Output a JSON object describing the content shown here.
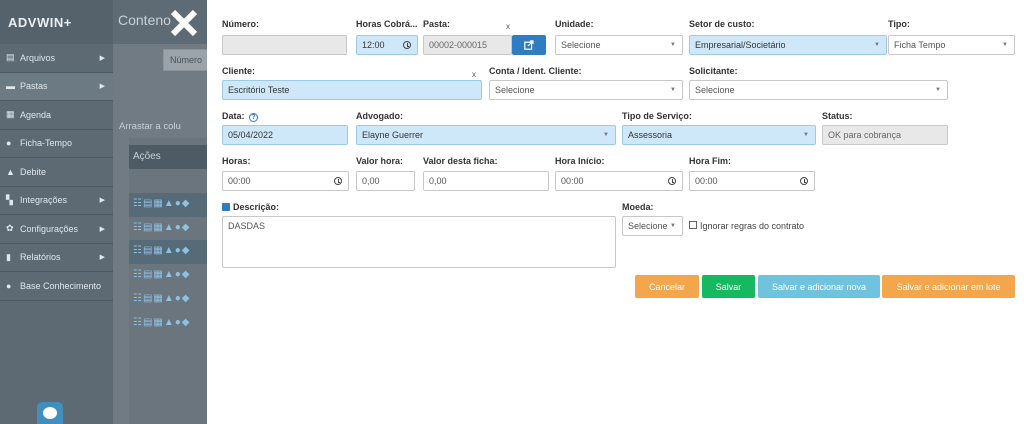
{
  "app": {
    "brand": "ADVWIN+",
    "header_title": "Conteno",
    "colors": {
      "sidebar": "#5d6a74",
      "primary": "#2f7dc0",
      "highlight_field": "#cfe8f9",
      "cancel": "#f3a64b",
      "save": "#16b95f",
      "save_new": "#6fc3df"
    }
  },
  "sidebar": {
    "items": [
      {
        "label": "Arquivos",
        "icon": "folder-icon",
        "glyph": "▤",
        "arrow": "▶"
      },
      {
        "label": "Pastas",
        "icon": "folder-open-icon",
        "glyph": "▬",
        "arrow": "▶"
      },
      {
        "label": "Agenda",
        "icon": "calendar-icon",
        "glyph": "▦",
        "arrow": ""
      },
      {
        "label": "Ficha-Tempo",
        "icon": "clock-icon",
        "glyph": "●",
        "arrow": ""
      },
      {
        "label": "Debite",
        "icon": "money-icon",
        "glyph": "▲",
        "arrow": ""
      },
      {
        "label": "Integrações",
        "icon": "sitemap-icon",
        "glyph": "▚",
        "arrow": "▶"
      },
      {
        "label": "Configurações",
        "icon": "gears-icon",
        "glyph": "✿",
        "arrow": "▶"
      },
      {
        "label": "Relatórios",
        "icon": "file-icon",
        "glyph": "▮",
        "arrow": "▶"
      },
      {
        "label": "Base Conhecimento",
        "icon": "info-icon",
        "glyph": "●",
        "arrow": ""
      }
    ]
  },
  "background": {
    "numero_placeholder": "Número",
    "arrastar_text": "Arrastar a colu",
    "acoes_header": "Ações",
    "row_icons": "☷▤▦▲●◆"
  },
  "form": {
    "numero": {
      "label": "Número:",
      "value": ""
    },
    "horas_cobradas": {
      "label": "Horas Cobrá...",
      "value": "12:00"
    },
    "pasta": {
      "label": "Pasta:",
      "value": "00002-000015",
      "clear": "x"
    },
    "unidade": {
      "label": "Unidade:",
      "value": "Selecione"
    },
    "setor_custo": {
      "label": "Setor de custo:",
      "value": "Empresarial/Societário"
    },
    "tipo": {
      "label": "Tipo:",
      "value": "Ficha Tempo"
    },
    "cliente": {
      "label": "Cliente:",
      "value": "Escritório Teste",
      "clear": "x"
    },
    "conta": {
      "label": "Conta / Ident. Cliente:",
      "value": "Selecione"
    },
    "solicitante": {
      "label": "Solicitante:",
      "value": "Selecione"
    },
    "data": {
      "label": "Data:",
      "help": "?",
      "value": "05/04/2022"
    },
    "advogado": {
      "label": "Advogado:",
      "value": "Elayne Guerrer"
    },
    "tipo_servico": {
      "label": "Tipo de Serviço:",
      "value": "Assessoria"
    },
    "status": {
      "label": "Status:",
      "value": "OK para cobrança"
    },
    "horas": {
      "label": "Horas:",
      "value": "00:00"
    },
    "valor_hora": {
      "label": "Valor hora:",
      "value": "0,00"
    },
    "valor_ficha": {
      "label": "Valor desta ficha:",
      "value": "0,00"
    },
    "hora_inicio": {
      "label": "Hora Início:",
      "value": "00:00"
    },
    "hora_fim": {
      "label": "Hora Fim:",
      "value": "00:00"
    },
    "descricao": {
      "label": "Descrição:",
      "value": "DASDAS"
    },
    "moeda": {
      "label": "Moeda:",
      "value": "Selecione"
    },
    "ignorar": {
      "label": "Ignorar regras do contrato",
      "checked": false
    }
  },
  "buttons": {
    "cancel": "Cancelar",
    "save": "Salvar",
    "save_new": "Salvar e adicionar nova",
    "save_batch": "Salvar e adicionar em lote"
  },
  "glyphs": {
    "caret": "▼"
  }
}
